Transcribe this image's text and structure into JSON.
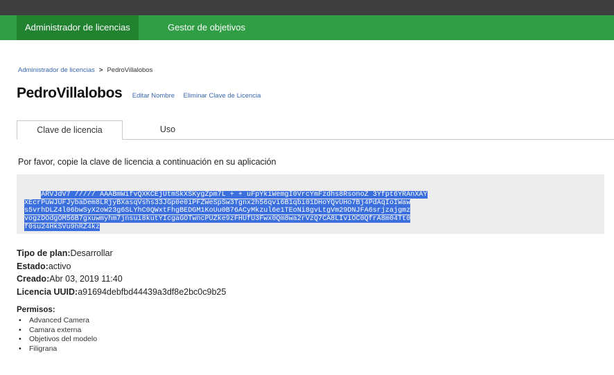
{
  "nav": {
    "items": [
      {
        "label": "Administrador de licencias",
        "active": true
      },
      {
        "label": "Gestor de objetivos",
        "active": false
      }
    ]
  },
  "breadcrumb": {
    "parent": "Administrador de licencias",
    "separator": ">",
    "current": "PedroVillalobos"
  },
  "page": {
    "title": "PedroVillalobos",
    "edit_link": "Editar Nombre",
    "delete_link": "Eliminar Clave de Licencia"
  },
  "tabs": [
    {
      "label": "Clave de licencia",
      "active": true
    },
    {
      "label": "Uso",
      "active": false
    }
  ],
  "instructions": "Por favor, copie la clave de licencia a continuación en su aplicación",
  "license_key_lines": [
    "ARVJdV7 ///// AAABmWifvQXKCEjUtmSkXSKygZpm7L + + uFpYkiWemgI0VrcYmFzdhs8RsonoZ 3Yfpt6YRAnXAY",
    "XEcrPuWJUFJybaDem8LRjyBXasqVshs33JGp0e0iPFZWeSpSw3Tgnx2h56qvi6B1qbi01DHoYQvUHo7Bj4PdAqIoIWaw",
    "s5vrhDLZ4l06bwSyX2oW23g6SLYhC0QWxtFhgBEDGM1KoUu0B76ACyMkzul6e1TEoNi8gvLtgVm29DNJFA6srjzajgmz",
    "vogzDOdgOM56B7gxuwmyhm7jnsui8kutYIcgaGOTwncPUZke9zFHUfU3Fwx0Qm8wa2rVzQ7CA8LIviOC0QfrA8m04Tt0",
    "f0su24HkSVu9hRZ4kz"
  ],
  "info": {
    "plan_label": "Tipo de plan:",
    "plan_value": "Desarrollar",
    "status_label": "Estado:",
    "status_value": "activo",
    "created_label": "Creado:",
    "created_value": "Abr 03, 2019 11:40",
    "uuid_label": "Licencia UUID:",
    "uuid_value": "a91694debfbd44439a3df8e2bc0c9b25"
  },
  "permissions": {
    "title": "Permisos:",
    "items": [
      "Advanced Camera",
      "Camara externa",
      "Objetivos del modelo",
      "Filigrana"
    ]
  },
  "colors": {
    "nav_green": "#2f9e44",
    "nav_active": "#21832f",
    "link_blue": "#3a68b0",
    "selection_blue": "#3b6fdd"
  }
}
